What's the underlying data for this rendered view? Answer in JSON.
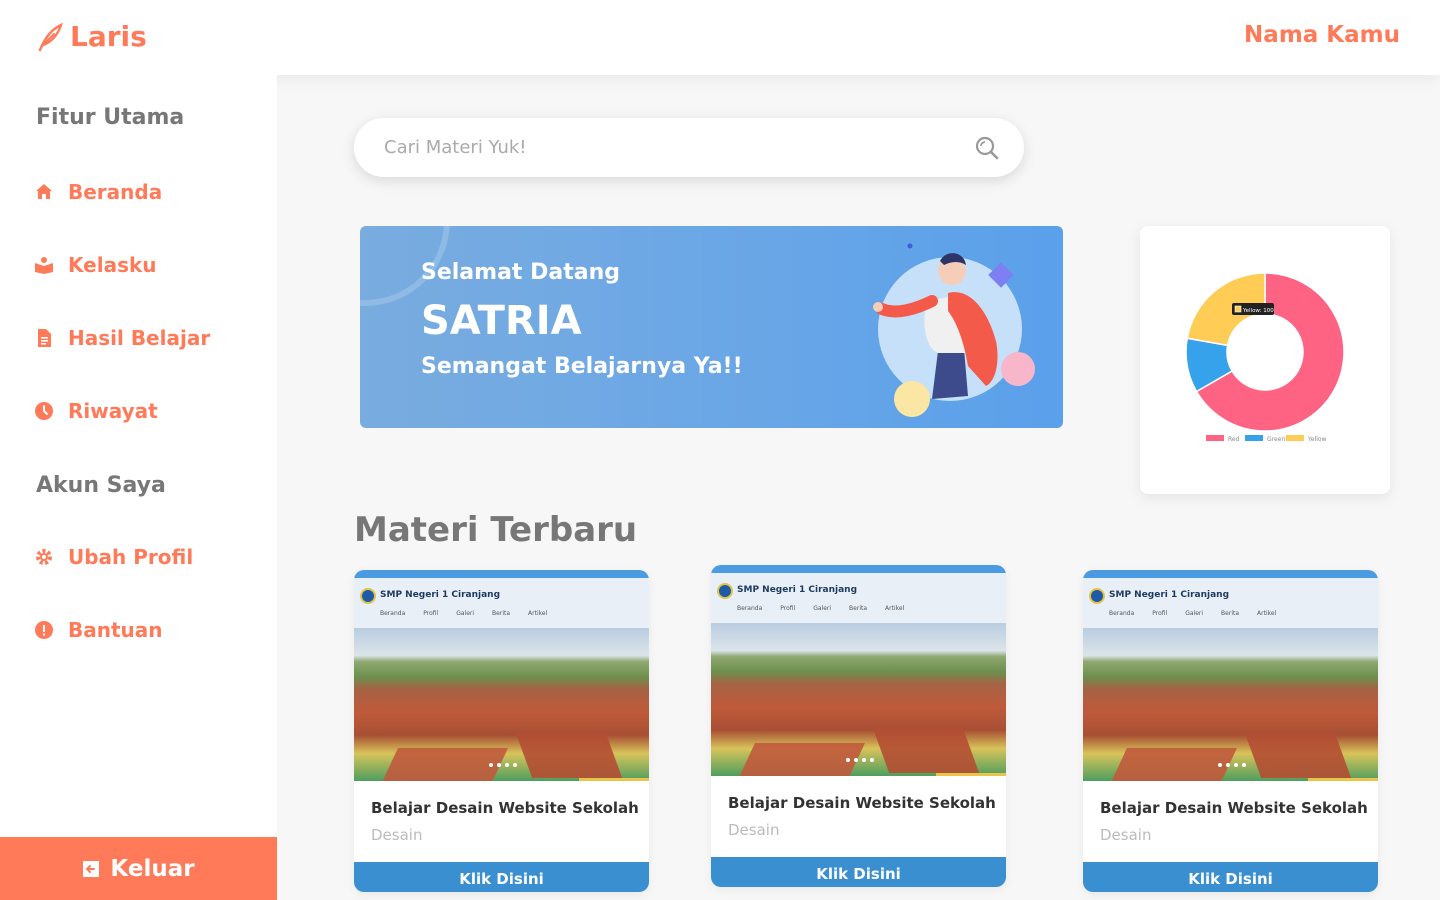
{
  "brand": {
    "name": "Laris",
    "color": "#ff7a59"
  },
  "header": {
    "user_name": "Nama Kamu"
  },
  "sidebar": {
    "section_main": "Fitur Utama",
    "section_account": "Akun Saya",
    "items": [
      {
        "label": "Beranda",
        "icon": "home-icon"
      },
      {
        "label": "Kelasku",
        "icon": "book-icon"
      },
      {
        "label": "Hasil Belajar",
        "icon": "document-icon"
      },
      {
        "label": "Riwayat",
        "icon": "clock-icon"
      },
      {
        "label": "Ubah Profil",
        "icon": "gear-icon"
      },
      {
        "label": "Bantuan",
        "icon": "info-icon"
      }
    ],
    "logout_label": "Keluar"
  },
  "search": {
    "placeholder": "Cari Materi Yuk!",
    "value": ""
  },
  "banner": {
    "greeting": "Selamat Datang",
    "name": "SATRIA",
    "message": "Semangat Belajarnya Ya!!"
  },
  "chart_data": {
    "type": "pie",
    "categories": [
      "Red",
      "Green",
      "Yellow"
    ],
    "values": [
      300,
      50,
      100
    ],
    "colors": [
      "#ff6384",
      "#36a2eb",
      "#ffcd56"
    ],
    "tooltip": "Yellow: 100",
    "legend_position": "bottom",
    "donut": true
  },
  "section_title": "Materi Terbaru",
  "courses": [
    {
      "title": "Belajar Desain Website Sekolah",
      "category": "Desain",
      "button": "Klik Disini",
      "thumb": {
        "school": "SMP Negeri 1 Ciranjang",
        "nav": [
          "Beranda",
          "Profil",
          "Galeri",
          "Berita",
          "Artikel"
        ]
      }
    },
    {
      "title": "Belajar Desain Website Sekolah",
      "category": "Desain",
      "button": "Klik Disini",
      "thumb": {
        "school": "SMP Negeri 1 Ciranjang",
        "nav": [
          "Beranda",
          "Profil",
          "Galeri",
          "Berita",
          "Artikel"
        ]
      }
    },
    {
      "title": "Belajar Desain Website Sekolah",
      "category": "Desain",
      "button": "Klik Disini",
      "thumb": {
        "school": "SMP Negeri 1 Ciranjang",
        "nav": [
          "Beranda",
          "Profil",
          "Galeri",
          "Berita",
          "Artikel"
        ]
      }
    }
  ]
}
